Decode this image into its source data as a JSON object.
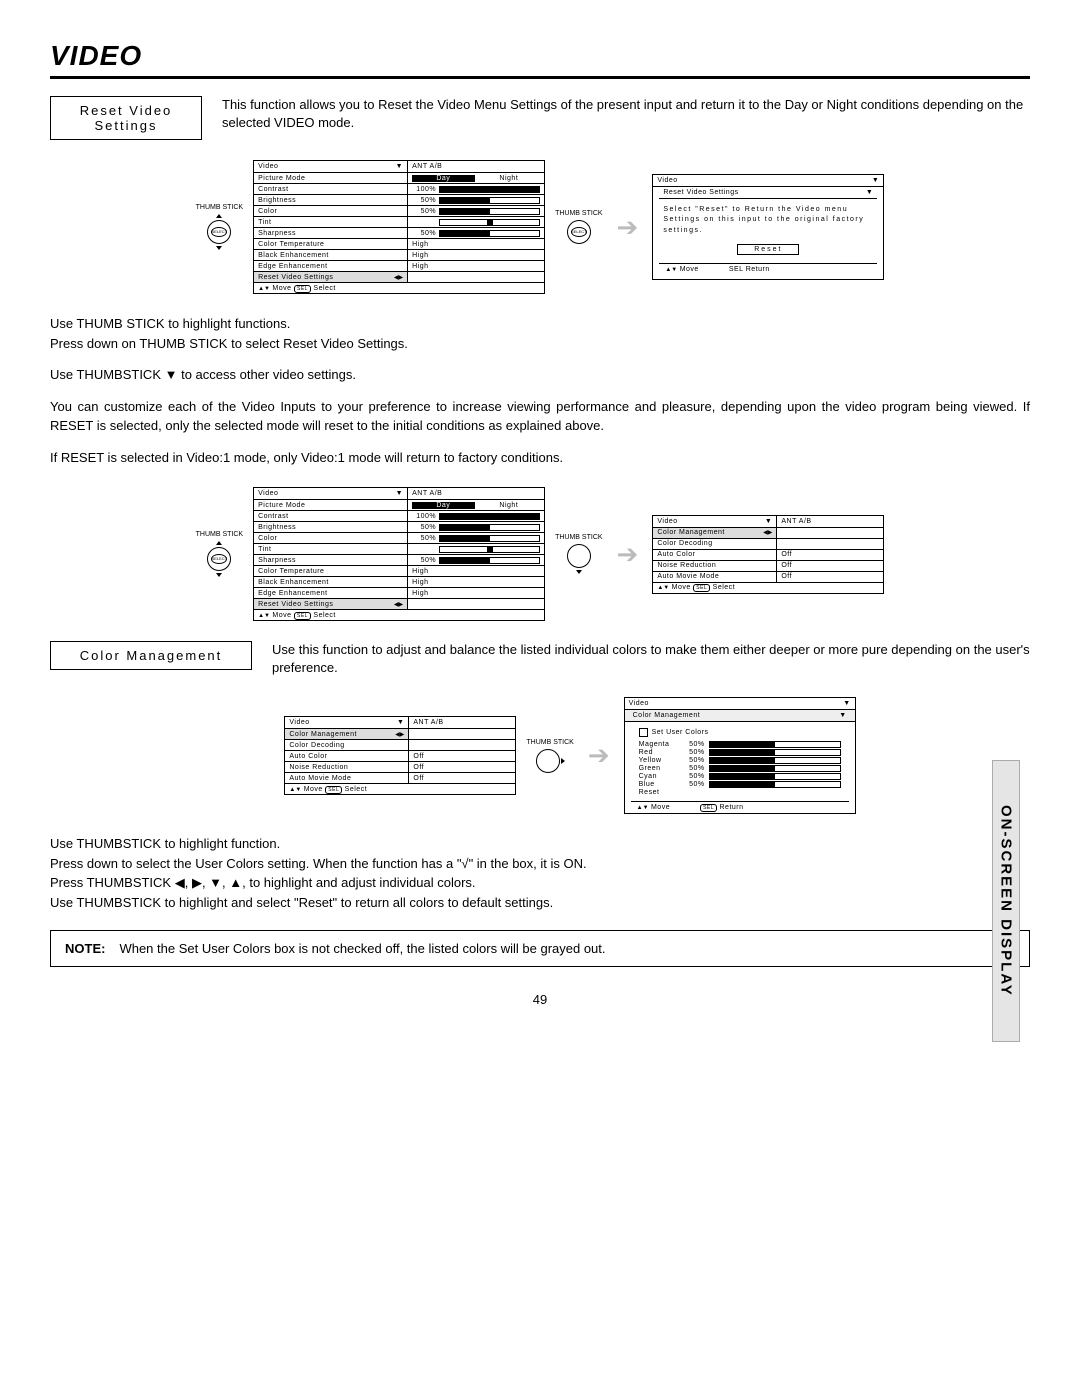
{
  "title": "VIDEO",
  "side_tab": "ON-SCREEN DISPLAY",
  "page_number": "49",
  "reset_section": {
    "heading": "Reset Video Settings",
    "intro": "This function allows you to Reset the Video Menu Settings of the present input and return it to the Day or Night conditions depending on the selected VIDEO mode."
  },
  "thumb": {
    "label": "THUMB STICK",
    "select": "SELECT"
  },
  "arrow": "➔",
  "video_menu": {
    "title": "Video",
    "source": "ANT A/B",
    "picture_mode": {
      "label": "Picture Mode",
      "day": "Day",
      "night": "Night"
    },
    "rows": [
      {
        "label": "Contrast",
        "pct": "100%",
        "fill": 100
      },
      {
        "label": "Brightness",
        "pct": "50%",
        "fill": 50
      },
      {
        "label": "Color",
        "pct": "50%",
        "fill": 50
      },
      {
        "label": "Tint",
        "pct": "",
        "tint": 50
      },
      {
        "label": "Sharpness",
        "pct": "50%",
        "fill": 50
      },
      {
        "label": "Color Temperature",
        "pct": "High"
      },
      {
        "label": "Black Enhancement",
        "pct": "High"
      },
      {
        "label": "Edge Enhancement",
        "pct": "High"
      }
    ],
    "reset_row": "Reset Video Settings",
    "foot_move": "Move",
    "foot_sel_badge": "SEL",
    "foot_select": "Select"
  },
  "reset_dialog": {
    "title": "Video",
    "sub": "Reset Video Settings",
    "msg": "Select \"Reset\" to Return the Video menu Settings on this input to the original factory settings.",
    "btn": "Reset",
    "ft_move": "Move",
    "ft_return": "Return",
    "ft_badge": "SEL"
  },
  "instructions1": [
    "Use THUMB STICK to highlight functions.",
    "Press down on THUMB STICK to select Reset Video Settings."
  ],
  "instructions2": "Use THUMBSTICK ▼ to access other video settings.",
  "instructions3": "You can customize each of the Video Inputs to your preference to increase viewing performance and pleasure, depending upon the video program being viewed. If RESET is selected, only the selected mode will reset to the initial conditions as explained above.",
  "instructions4": "If RESET is selected in Video:1 mode, only Video:1 mode will return to factory conditions.",
  "cm_menu": {
    "title": "Video",
    "source": "ANT A/B",
    "rows": [
      {
        "label": "Color Management",
        "arrows": "◀▶"
      },
      {
        "label": "Color Decoding",
        "val": ""
      },
      {
        "label": "Auto Color",
        "val": "Off"
      },
      {
        "label": "Noise Reduction",
        "val": "Off"
      },
      {
        "label": "Auto Movie Mode",
        "val": "Off"
      }
    ],
    "foot_move": "Move",
    "foot_sel_badge": "SEL",
    "foot_select": "Select"
  },
  "cm_section": {
    "heading": "Color Management",
    "intro": "Use this function to adjust and balance the listed individual colors to make them either deeper or more pure depending on the user's preference."
  },
  "color_adjust": {
    "title": "Video",
    "sub": "Color Management",
    "set_label": "Set User Colors",
    "colors": [
      {
        "name": "Magenta",
        "pct": "50%",
        "fill": 50
      },
      {
        "name": "Red",
        "pct": "50%",
        "fill": 50
      },
      {
        "name": "Yellow",
        "pct": "50%",
        "fill": 50
      },
      {
        "name": "Green",
        "pct": "50%",
        "fill": 50
      },
      {
        "name": "Cyan",
        "pct": "50%",
        "fill": 50
      },
      {
        "name": "Blue",
        "pct": "50%",
        "fill": 50
      }
    ],
    "reset": "Reset",
    "ft_move": "Move",
    "ft_badge": "SEL",
    "ft_return": "Return"
  },
  "instructions5": [
    "Use THUMBSTICK to highlight function.",
    "Press down to select the User Colors setting.  When the function has a \"√\" in the box, it is ON.",
    "Press THUMBSTICK ◀, ▶, ▼, ▲, to highlight and adjust individual colors.",
    "Use THUMBSTICK to highlight and select \"Reset\" to return all colors to default settings."
  ],
  "note": {
    "label": "NOTE:",
    "text": "When the Set User Colors box is not checked off, the listed colors will be grayed out."
  }
}
